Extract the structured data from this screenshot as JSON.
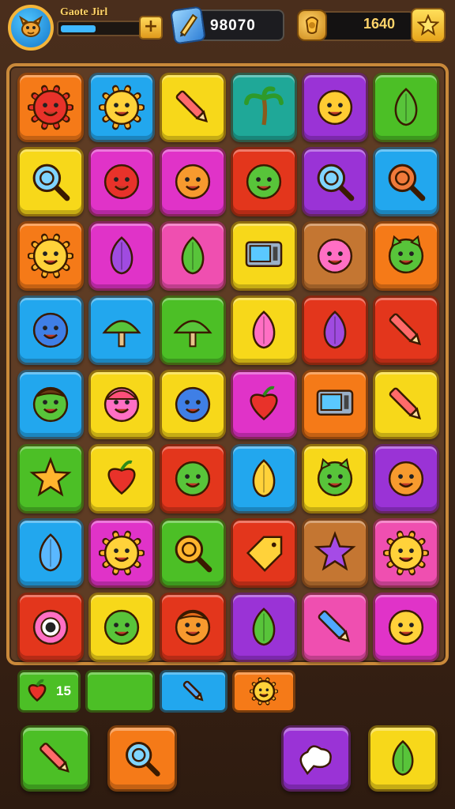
{
  "hud": {
    "player_name": "Gaote Jirl",
    "xp_progress": 0.45,
    "gems": "98070",
    "coins": "1640",
    "avatar_icon": "dog-face-icon",
    "gem_icon": "blue-gem-icon",
    "coin_icon": "coin-badge-icon",
    "star_icon": "star-icon"
  },
  "colors": {
    "orange": "#f57a18",
    "blue": "#22a7ee",
    "yellow": "#f7d81a",
    "teal": "#1fa898",
    "purple": "#9a33d6",
    "green": "#4cbf26",
    "magenta": "#e033c8",
    "pink": "#ef4fb0",
    "red": "#e3361c",
    "brown": "#c47632"
  },
  "board": {
    "rows": [
      [
        {
          "icon": "red-sun-icon",
          "color": "orange"
        },
        {
          "icon": "smiling-sun-icon",
          "color": "blue"
        },
        {
          "icon": "pencil-icon",
          "color": "yellow"
        },
        {
          "icon": "palm-tree-icon",
          "color": "teal"
        },
        {
          "icon": "cookie-face-icon",
          "color": "purple"
        },
        {
          "icon": "leaf-icon",
          "color": "green"
        }
      ],
      [
        {
          "icon": "magnifier-icon",
          "color": "yellow"
        },
        {
          "icon": "red-blob-face-icon",
          "color": "magenta"
        },
        {
          "icon": "orange-blob-face-icon",
          "color": "magenta"
        },
        {
          "icon": "green-spiky-face-icon",
          "color": "red"
        },
        {
          "icon": "target-shield-icon",
          "color": "purple"
        },
        {
          "icon": "spiral-lollipop-icon",
          "color": "blue"
        }
      ],
      [
        {
          "icon": "orange-sun-face-icon",
          "color": "orange"
        },
        {
          "icon": "purple-leaf-icon",
          "color": "magenta"
        },
        {
          "icon": "green-potion-icon",
          "color": "pink"
        },
        {
          "icon": "microwave-icon",
          "color": "yellow"
        },
        {
          "icon": "pink-ghost-icon",
          "color": "brown"
        },
        {
          "icon": "green-cat-face-icon",
          "color": "orange"
        }
      ],
      [
        {
          "icon": "blue-ball-face-icon",
          "color": "blue"
        },
        {
          "icon": "green-mushroom-icon",
          "color": "blue"
        },
        {
          "icon": "green-boat-icon",
          "color": "green"
        },
        {
          "icon": "pink-radish-icon",
          "color": "yellow"
        },
        {
          "icon": "purple-balloon-icon",
          "color": "red"
        },
        {
          "icon": "screwdriver-icon",
          "color": "red"
        }
      ],
      [
        {
          "icon": "green-hair-face-icon",
          "color": "blue"
        },
        {
          "icon": "pink-cap-face-icon",
          "color": "yellow"
        },
        {
          "icon": "blue-bug-face-icon",
          "color": "yellow"
        },
        {
          "icon": "red-apple-icon",
          "color": "magenta"
        },
        {
          "icon": "laptop-icon",
          "color": "orange"
        },
        {
          "icon": "paintbrush-icon",
          "color": "yellow"
        }
      ],
      [
        {
          "icon": "orange-star-face-icon",
          "color": "green"
        },
        {
          "icon": "red-heart-apple-icon",
          "color": "yellow"
        },
        {
          "icon": "green-virus-face-icon",
          "color": "red"
        },
        {
          "icon": "yellow-carrot-icon",
          "color": "blue"
        },
        {
          "icon": "green-cat-ball-icon",
          "color": "yellow"
        },
        {
          "icon": "orange-pot-face-icon",
          "color": "purple"
        }
      ],
      [
        {
          "icon": "blue-drop-face-icon",
          "color": "blue"
        },
        {
          "icon": "heart-sun-icon",
          "color": "magenta"
        },
        {
          "icon": "orange-ring-icon",
          "color": "green"
        },
        {
          "icon": "yellow-tag-icon",
          "color": "red"
        },
        {
          "icon": "purple-star-icon",
          "color": "brown"
        },
        {
          "icon": "orange-gear-face-icon",
          "color": "pink"
        }
      ],
      [
        {
          "icon": "pink-eye-monster-icon",
          "color": "red"
        },
        {
          "icon": "green-cactus-face-icon",
          "color": "yellow"
        },
        {
          "icon": "orange-hair-face-icon",
          "color": "red"
        },
        {
          "icon": "green-bottle-icon",
          "color": "purple"
        },
        {
          "icon": "blue-pen-icon",
          "color": "pink"
        },
        {
          "icon": "yellow-ball-face-icon",
          "color": "magenta"
        }
      ]
    ]
  },
  "tray": {
    "slots": [
      {
        "icon": "red-apple-icon",
        "count": "15",
        "color": "green"
      },
      {
        "icon": "",
        "count": "",
        "color": "green"
      },
      {
        "icon": "blue-ruler-icon",
        "count": "",
        "color": "blue"
      },
      {
        "icon": "sun-face-icon",
        "count": "",
        "color": "orange"
      }
    ]
  },
  "actions": [
    {
      "icon": "pencil-icon",
      "color": "green"
    },
    {
      "icon": "magnifier-icon",
      "color": "orange"
    },
    {
      "icon": "cloud-bubble-icon",
      "color": "purple"
    },
    {
      "icon": "leaf-swirl-icon",
      "color": "yellow"
    }
  ]
}
